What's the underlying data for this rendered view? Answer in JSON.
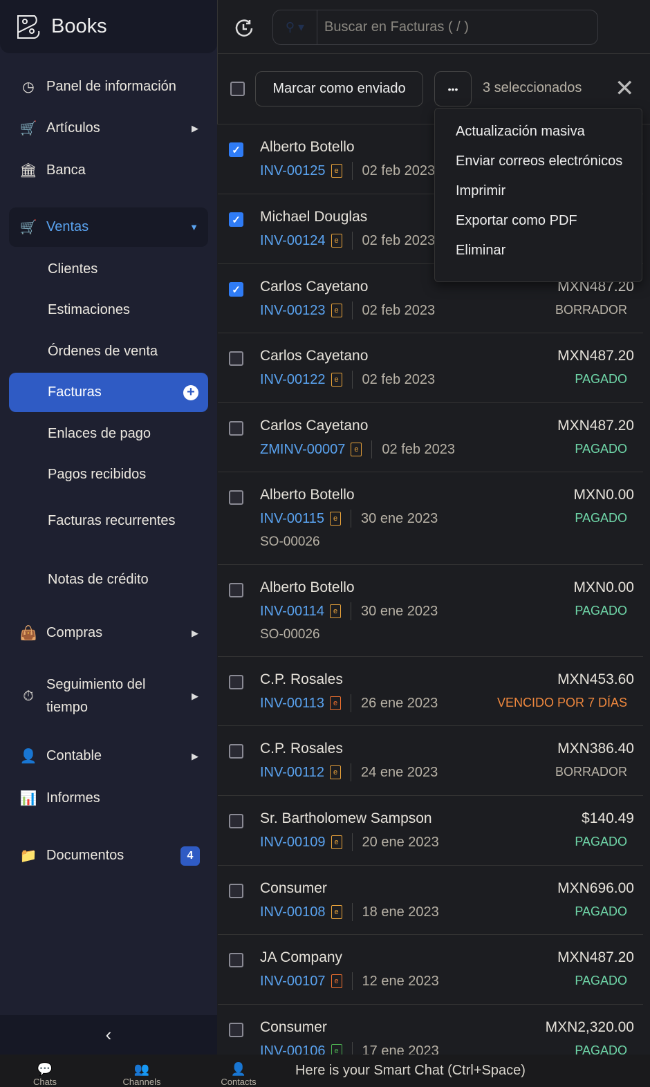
{
  "app": {
    "title": "Books"
  },
  "sidebar": {
    "items": [
      {
        "label": "Panel de información",
        "icon": "gauge-icon"
      },
      {
        "label": "Artículos",
        "icon": "basket-icon"
      },
      {
        "label": "Banca",
        "icon": "bank-icon"
      },
      {
        "label": "Ventas",
        "icon": "cart-icon"
      },
      {
        "label": "Clientes"
      },
      {
        "label": "Estimaciones"
      },
      {
        "label": "Órdenes de venta"
      },
      {
        "label": "Facturas"
      },
      {
        "label": "Enlaces de pago"
      },
      {
        "label": "Pagos recibidos"
      },
      {
        "label": "Facturas recurrentes"
      },
      {
        "label": "Notas de crédito"
      },
      {
        "label": "Compras",
        "icon": "bag-icon"
      },
      {
        "label": "Seguimiento del tiempo",
        "icon": "timer-icon"
      },
      {
        "label": "Contable",
        "icon": "accountant-icon"
      },
      {
        "label": "Informes",
        "icon": "chart-icon"
      },
      {
        "label": "Documentos",
        "icon": "folder-icon",
        "badge": "4"
      }
    ]
  },
  "header": {
    "search_placeholder": "Buscar en Facturas ( / )"
  },
  "toolbar": {
    "mark_sent": "Marcar como enviado",
    "more": "•••",
    "selected": "3 seleccionados"
  },
  "menu": [
    "Actualización masiva",
    "Enviar correos electrónicos",
    "Imprimir",
    "Exportar como PDF",
    "Eliminar"
  ],
  "colors": {
    "accent": "#2f5bc4",
    "link": "#5aa3f0",
    "paid": "#6fd6a8",
    "overdue": "#f0883e",
    "draft": "#b8b2a6"
  },
  "invoices": [
    {
      "customer": "Alberto Botello",
      "number": "INV-00125",
      "date": "02 feb 2023",
      "amount": "",
      "status": "",
      "checked": true,
      "icon_color": "#e8a23a"
    },
    {
      "customer": "Michael Douglas",
      "number": "INV-00124",
      "date": "02 feb 2023",
      "amount": "",
      "status": "",
      "checked": true,
      "icon_color": "#e8a23a"
    },
    {
      "customer": "Carlos Cayetano",
      "number": "INV-00123",
      "date": "02 feb 2023",
      "amount": "MXN487.20",
      "status": "BORRADOR",
      "checked": true,
      "icon_color": "#e8a23a"
    },
    {
      "customer": "Carlos Cayetano",
      "number": "INV-00122",
      "date": "02 feb 2023",
      "amount": "MXN487.20",
      "status": "PAGADO",
      "checked": false,
      "icon_color": "#e8a23a"
    },
    {
      "customer": "Carlos Cayetano",
      "number": "ZMINV-00007",
      "date": "02 feb 2023",
      "amount": "MXN487.20",
      "status": "PAGADO",
      "checked": false,
      "icon_color": "#e8a23a"
    },
    {
      "customer": "Alberto Botello",
      "number": "INV-00115",
      "date": "30 ene 2023",
      "so": "SO-00026",
      "amount": "MXN0.00",
      "status": "PAGADO",
      "checked": false,
      "icon_color": "#e8a23a"
    },
    {
      "customer": "Alberto Botello",
      "number": "INV-00114",
      "date": "30 ene 2023",
      "so": "SO-00026",
      "amount": "MXN0.00",
      "status": "PAGADO",
      "checked": false,
      "icon_color": "#e8a23a"
    },
    {
      "customer": "C.P. Rosales",
      "number": "INV-00113",
      "date": "26 ene 2023",
      "amount": "MXN453.60",
      "status": "VENCIDO POR 7 DÍAS",
      "checked": false,
      "icon_color": "#f0702e"
    },
    {
      "customer": "C.P. Rosales",
      "number": "INV-00112",
      "date": "24 ene 2023",
      "amount": "MXN386.40",
      "status": "BORRADOR",
      "checked": false,
      "icon_color": "#e8a23a"
    },
    {
      "customer": "Sr. Bartholomew Sampson",
      "number": "INV-00109",
      "date": "20 ene 2023",
      "amount": "$140.49",
      "status": "PAGADO",
      "checked": false,
      "icon_color": "#e8a23a"
    },
    {
      "customer": "Consumer",
      "number": "INV-00108",
      "date": "18 ene 2023",
      "amount": "MXN696.00",
      "status": "PAGADO",
      "checked": false,
      "icon_color": "#e8a23a"
    },
    {
      "customer": "JA Company",
      "number": "INV-00107",
      "date": "12 ene 2023",
      "amount": "MXN487.20",
      "status": "PAGADO",
      "checked": false,
      "icon_color": "#f0702e"
    },
    {
      "customer": "Consumer",
      "number": "INV-00106",
      "date": "17 ene 2023",
      "amount": "MXN2,320.00",
      "status": "PAGADO",
      "checked": false,
      "icon_color": "#4caf50"
    }
  ],
  "bottombar": {
    "chats": "Chats",
    "channels": "Channels",
    "contacts": "Contacts",
    "smart_chat": "Here is your Smart Chat (Ctrl+Space)"
  }
}
